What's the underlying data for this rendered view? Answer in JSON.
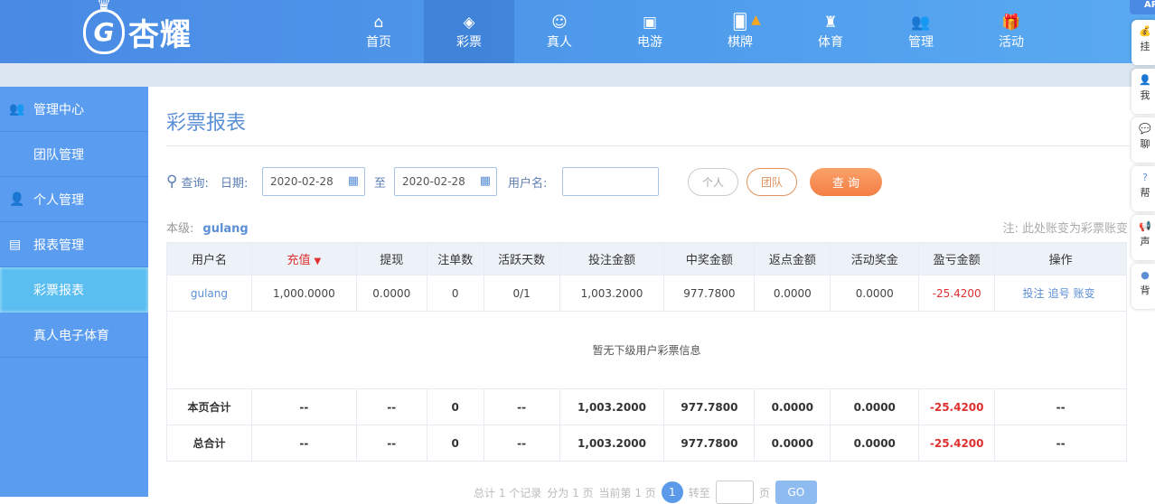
{
  "header": {
    "logo_text": "杏耀",
    "logo_letter": "G",
    "nav": [
      {
        "label": "首页",
        "icon": "home-icon",
        "glyph": "⌂"
      },
      {
        "label": "彩票",
        "icon": "lottery-ticket-icon",
        "glyph": "◈"
      },
      {
        "label": "真人",
        "icon": "live-dealer-icon",
        "glyph": "☺"
      },
      {
        "label": "电游",
        "icon": "slot-machine-icon",
        "glyph": "▣"
      },
      {
        "label": "棋牌",
        "icon": "cards-icon",
        "glyph": "🂠"
      },
      {
        "label": "体育",
        "icon": "trophy-icon",
        "glyph": "♜"
      },
      {
        "label": "管理",
        "icon": "users-icon",
        "glyph": "👥"
      },
      {
        "label": "活动",
        "icon": "gift-icon",
        "glyph": "🎁"
      }
    ],
    "active": "彩票"
  },
  "sidebar": {
    "items": [
      {
        "label": "管理中心",
        "icon": "users-icon",
        "glyph": "👥"
      },
      {
        "label": "团队管理"
      },
      {
        "label": "个人管理",
        "icon": "user-icon",
        "glyph": "👤"
      },
      {
        "label": "报表管理",
        "icon": "document-icon",
        "glyph": "▤"
      },
      {
        "label": "彩票报表"
      },
      {
        "label": "真人电子体育"
      }
    ]
  },
  "page": {
    "title": "彩票报表"
  },
  "query": {
    "label": "查询:",
    "date_label": "日期:",
    "date_from": "2020-02-28",
    "to_label": "至",
    "date_to": "2020-02-28",
    "username_label": "用户名:",
    "username_value": "",
    "btn_personal": "个人",
    "btn_team": "团队",
    "btn_search": "查 询"
  },
  "level": {
    "label": "本级:",
    "user": "gulang"
  },
  "note": "注: 此处账变为彩票账变",
  "table": {
    "headers": [
      "用户名",
      "充值",
      "提现",
      "注单数",
      "活跃天数",
      "投注金额",
      "中奖金额",
      "返点金额",
      "活动奖金",
      "盈亏金额",
      "操作"
    ],
    "sort_indicator": "▼",
    "rows": [
      [
        "gulang",
        "1,000.0000",
        "0.0000",
        "0",
        "0/1",
        "1,003.2000",
        "977.7800",
        "0.0000",
        "0.0000",
        "-25.4200"
      ]
    ],
    "actions": [
      "投注",
      "追号",
      "账变"
    ],
    "empty_text": "暂无下级用户彩票信息",
    "subtotal": [
      "本页合计",
      "--",
      "--",
      "0",
      "--",
      "1,003.2000",
      "977.7800",
      "0.0000",
      "0.0000",
      "-25.4200",
      "--"
    ],
    "total": [
      "总合计",
      "--",
      "--",
      "0",
      "--",
      "1,003.2000",
      "977.7800",
      "0.0000",
      "0.0000",
      "-25.4200",
      "--"
    ]
  },
  "pager": {
    "p1": "总计 1 个记录",
    "p2": "分为 1 页",
    "p3": "当前第 1 页",
    "current": "1",
    "goto": "转至",
    "page_unit": "页",
    "go": "GO"
  },
  "right_panel": {
    "top": "API",
    "items": [
      {
        "label": "挂",
        "icon": "money-bag-icon",
        "glyph": "💰"
      },
      {
        "label": "我",
        "icon": "user-icon",
        "glyph": "👤"
      },
      {
        "label": "聊",
        "icon": "chat-icon",
        "glyph": "💬"
      },
      {
        "label": "帮",
        "icon": "help-icon",
        "glyph": "?"
      },
      {
        "label": "声",
        "icon": "megaphone-icon",
        "glyph": "📢"
      },
      {
        "label": "背",
        "icon": "palette-icon",
        "glyph": "●"
      }
    ]
  },
  "colors": {
    "header": "#4a8ae4",
    "sidebar": "#5a9cf0",
    "active": "#5bbef0",
    "negative": "#e03030",
    "search_btn": "#f98c52"
  }
}
